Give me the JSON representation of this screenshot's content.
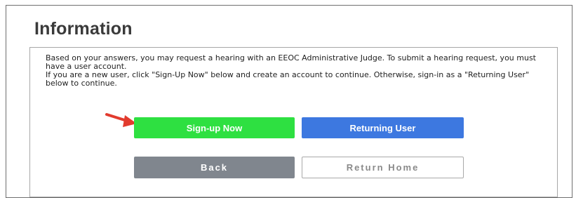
{
  "info": {
    "title": "Information",
    "paragraph1": "Based on your answers, you may request a hearing with an EEOC Administrative Judge. To submit a hearing request, you must have a user account.",
    "paragraph2": "If you are a new user, click \"Sign-Up Now\" below and create an account to continue. Otherwise, sign-in as a \"Returning User\" below to continue."
  },
  "buttons": {
    "signup_label": "Sign-up Now",
    "returning_label": "Returning User",
    "back_label": "Back",
    "home_label": "Return Home"
  },
  "colors": {
    "signup": "#2ee041",
    "returning": "#3d78e0",
    "back": "#80868e",
    "arrow": "#e23b2e"
  },
  "annotations": {
    "arrow_icon": "red-arrow-pointing-right"
  }
}
